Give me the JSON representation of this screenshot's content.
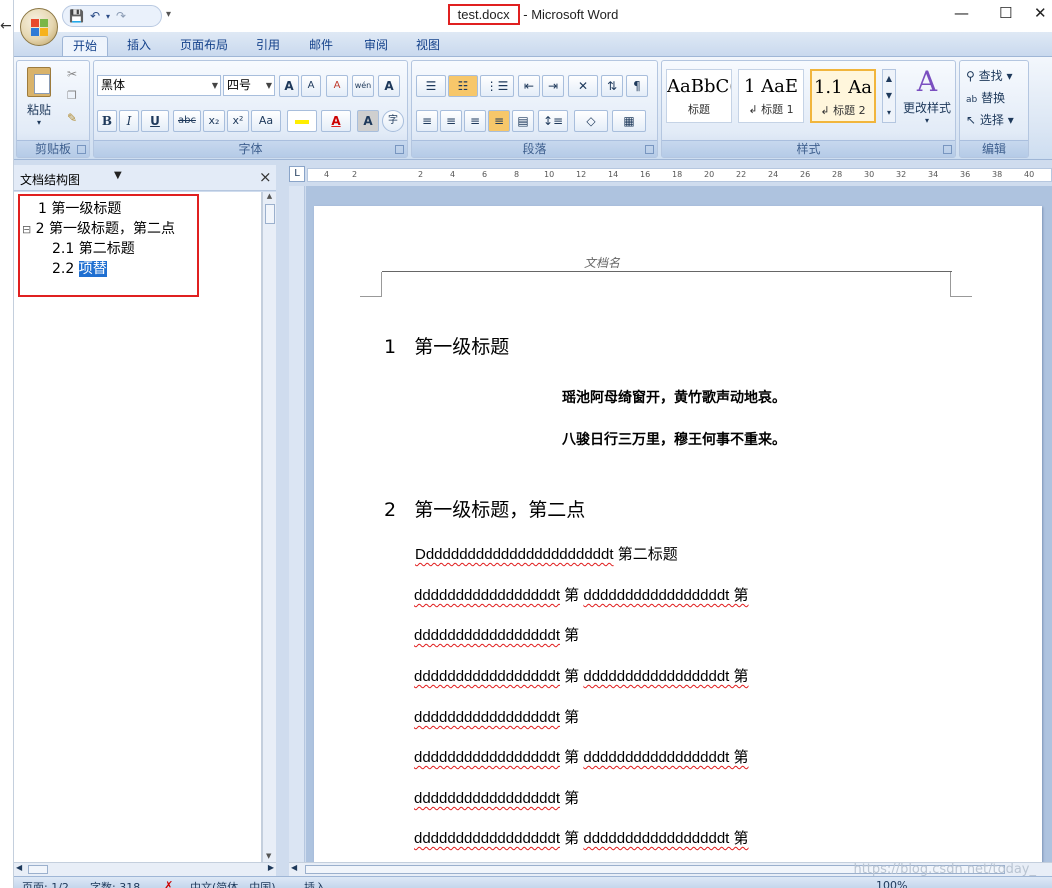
{
  "window": {
    "title_doc": "test.docx",
    "title_sep": " - ",
    "title_app": "Microsoft Word",
    "min": "—",
    "max": "☐",
    "close": "✕"
  },
  "qat": {
    "save": "💾",
    "undo": "↶",
    "redo": "↷",
    "more": "▾"
  },
  "tabs": [
    "开始",
    "插入",
    "页面布局",
    "引用",
    "邮件",
    "审阅",
    "视图"
  ],
  "ribbon": {
    "clipboard": {
      "paste": "粘贴",
      "label": "剪贴板"
    },
    "font": {
      "name": "黑体",
      "size": "四号",
      "bold": "B",
      "italic": "I",
      "underline": "U",
      "strike": "abc",
      "sub": "x₂",
      "sup": "x²",
      "case": "Aa",
      "grow": "A",
      "shrink": "A",
      "clear": "A",
      "wen": "wén",
      "border": "A",
      "shade": "A",
      "enclose": "字",
      "label": "字体"
    },
    "paragraph": {
      "label": "段落"
    },
    "styles": {
      "items": [
        {
          "preview": "AaBbC(",
          "name": "标题"
        },
        {
          "preview": "1  AaE",
          "name": "↲ 标题 1"
        },
        {
          "preview": "1.1  Aa",
          "name": "↲ 标题 2"
        }
      ],
      "change": "更改样式",
      "label": "样式"
    },
    "editing": {
      "find": "查找",
      "replace": "替换",
      "select": "选择",
      "label": "编辑"
    }
  },
  "pane": {
    "title": "文档结构图",
    "close": "×",
    "items": [
      {
        "num": "1",
        "text": "第一级标题"
      },
      {
        "num": "2",
        "text": "第一级标题，第二点",
        "toggle": "⊟"
      },
      {
        "num": "2.1",
        "text": "第二标题"
      },
      {
        "num": "2.2",
        "text": "项替"
      }
    ]
  },
  "ruler": [
    "4",
    "2",
    "2",
    "4",
    "6",
    "8",
    "10",
    "12",
    "14",
    "16",
    "18",
    "20",
    "22",
    "24",
    "26",
    "28",
    "30",
    "32",
    "34",
    "36",
    "38",
    "40"
  ],
  "document": {
    "header": "文档名",
    "h1a": {
      "num": "1",
      "text": "第一级标题"
    },
    "poem1": "瑶池阿母绮窗开，黄竹歌声动地哀。",
    "poem2": "八骏日行三万里，穆王何事不重来。",
    "h1b": {
      "num": "2",
      "text": "第一级标题，第二点"
    },
    "lines": [
      {
        "a": "Dddddddddddddddddddddddt",
        "b": "第二标题",
        "c": ""
      },
      {
        "a": "dddddddddddddddddt",
        "b": "第",
        "c": "dddddddddddddddddt 第"
      },
      {
        "a": "dddddddddddddddddt",
        "b": "第",
        "c": ""
      },
      {
        "a": "dddddddddddddddddt",
        "b": "第",
        "c": "dddddddddddddddddt 第"
      },
      {
        "a": "dddddddddddddddddt",
        "b": "第",
        "c": ""
      },
      {
        "a": "dddddddddddddddddt",
        "b": "第",
        "c": "dddddddddddddddddt 第"
      },
      {
        "a": "dddddddddddddddddt",
        "b": "第",
        "c": ""
      },
      {
        "a": "dddddddddddddddddt",
        "b": "第",
        "c": "dddddddddddddddddt 第"
      }
    ]
  },
  "status": {
    "page": "页面: 1/2",
    "words": "字数: 318",
    "lang": "中文(简体，中国)",
    "insert": "插入",
    "zoom": "100%"
  },
  "watermark": "https://blog.csdn.net/today_"
}
